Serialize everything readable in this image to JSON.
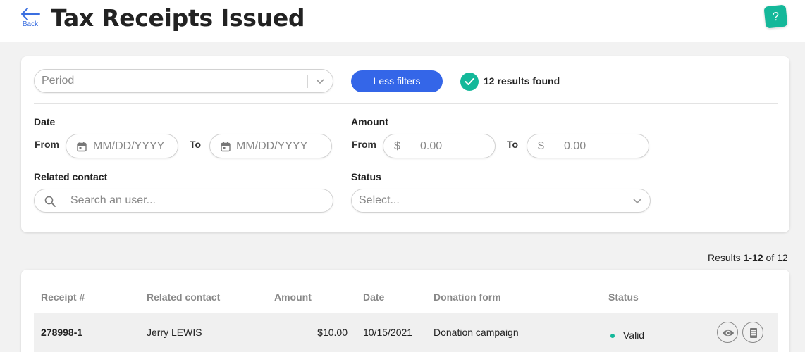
{
  "header": {
    "back_label": "Back",
    "title": "Tax Receipts Issued",
    "help_label": "?"
  },
  "filters": {
    "period_placeholder": "Period",
    "toggle_button": "Less filters",
    "results_found": "12 results found",
    "date": {
      "label": "Date",
      "from_label": "From",
      "to_label": "To",
      "from_placeholder": "MM/DD/YYYY",
      "to_placeholder": "MM/DD/YYYY"
    },
    "amount": {
      "label": "Amount",
      "from_label": "From",
      "to_label": "To",
      "currency": "$",
      "from_placeholder": "0.00",
      "to_placeholder": "0.00"
    },
    "related_contact": {
      "label": "Related contact",
      "placeholder": "Search an user..."
    },
    "status": {
      "label": "Status",
      "placeholder": "Select..."
    }
  },
  "results": {
    "prefix": "Results",
    "range": "1-12",
    "of_label": "of",
    "total": "12"
  },
  "table": {
    "columns": [
      "Receipt #",
      "Related contact",
      "Amount",
      "Date",
      "Donation form",
      "Status"
    ],
    "rows": [
      {
        "receipt": "278998-1",
        "contact": "Jerry LEWIS",
        "amount": "$10.00",
        "date": "10/15/2021",
        "form": "Donation campaign",
        "status": "Valid"
      }
    ]
  },
  "colors": {
    "accent": "#3466e8",
    "brand": "#14b89a",
    "status_valid": "#14b89a"
  },
  "icons": [
    "back-arrow-icon",
    "help-icon",
    "chevron-down-icon",
    "calendar-icon",
    "search-icon",
    "check-icon",
    "eye-icon",
    "document-icon"
  ]
}
